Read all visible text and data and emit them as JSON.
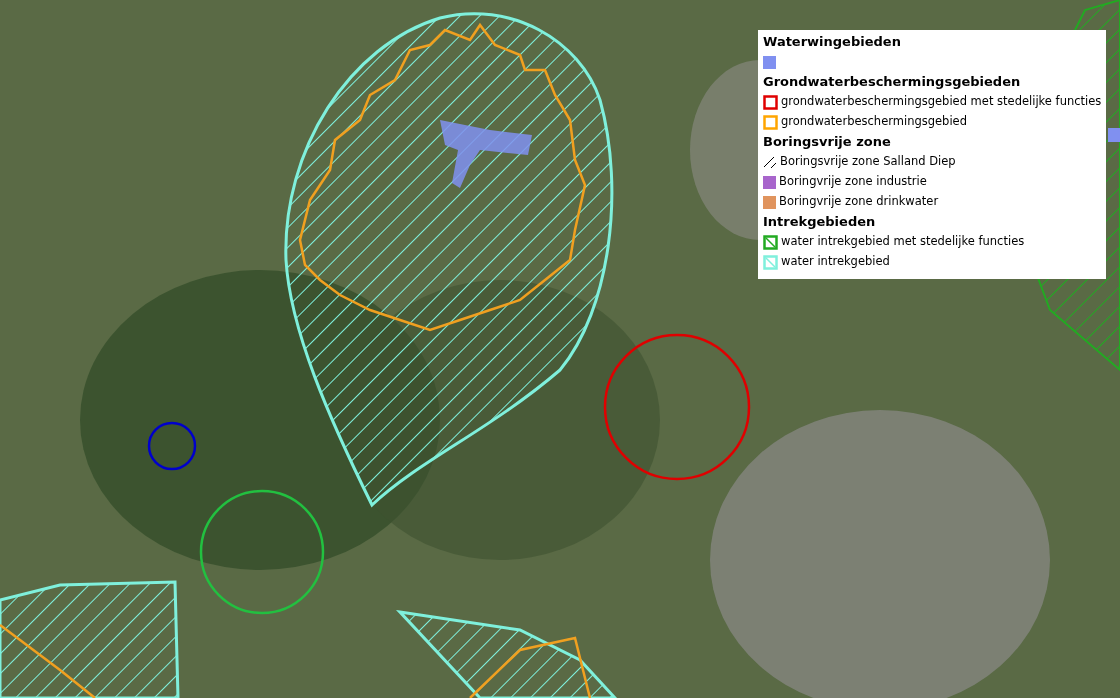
{
  "legend": {
    "sections": [
      {
        "title": "Waterwingebieden",
        "items": [
          {
            "kind": "fill",
            "color": "#8090f0"
          }
        ]
      },
      {
        "title": "Grondwaterbeschermingsgebieden",
        "items": [
          {
            "kind": "outline",
            "color": "#e00000",
            "label": "grondwaterbeschermingsgebied met stedelijke functies"
          },
          {
            "kind": "outline",
            "color": "#ffa500",
            "label": "grondwaterbeschermingsgebied"
          }
        ]
      },
      {
        "title": "Boringsvrije zone",
        "items": [
          {
            "kind": "hatch",
            "color": "#000000",
            "label": "Boringsvrije zone Salland Diep"
          },
          {
            "kind": "fill",
            "color": "#a865cc",
            "label": "Boringvrije zone industrie"
          },
          {
            "kind": "fill",
            "color": "#e0945e",
            "label": "Boringvrije zone drinkwater"
          }
        ]
      },
      {
        "title": "Intrekgebieden",
        "items": [
          {
            "kind": "hatched-outline",
            "color": "#22aa22",
            "label": "water intrekgebied met stedelijke functies"
          },
          {
            "kind": "hatched-outline",
            "color": "#7ff0dc",
            "label": "water intrekgebied"
          }
        ]
      }
    ]
  }
}
